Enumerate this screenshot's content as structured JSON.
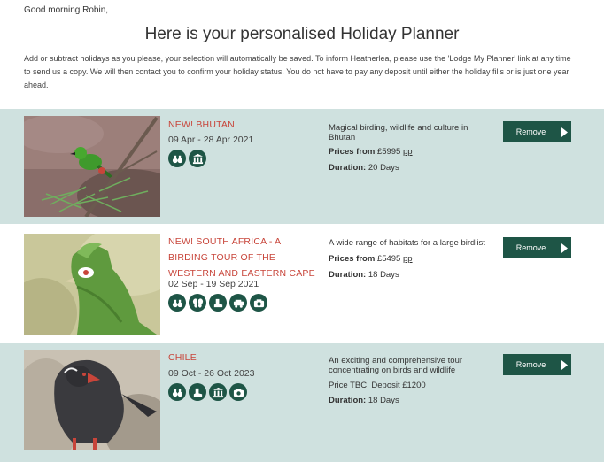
{
  "greeting": "Good morning Robin,",
  "page_title": "Here is your personalised Holiday Planner",
  "intro": "Add or subtract holidays as you please, your selection will automatically be saved. To inform Heatherlea, please use the 'Lodge My Planner' link at any time to send us a copy. We will then contact you to confirm your holiday status. You do not have to pay any deposit until either the holiday fills or is just one year ahead.",
  "colors": {
    "accent": "#1e5546",
    "title_red": "#c8453a",
    "row_shade": "#cfe1df"
  },
  "tours": [
    {
      "title": "NEW! BHUTAN",
      "dates": "09 Apr - 28 Apr 2021",
      "icons": [
        "binoculars-icon",
        "culture-icon"
      ],
      "description": "Magical birding, wildlife and culture in Bhutan",
      "price_label": "Prices from",
      "price_value": "£5995",
      "price_suffix": "pp",
      "duration_label": "Duration:",
      "duration_value": "20 Days",
      "remove_label": "Remove"
    },
    {
      "title": "NEW! SOUTH AFRICA - A BIRDING TOUR OF THE WESTERN AND EASTERN CAPE",
      "dates": "02 Sep - 19 Sep 2021",
      "icons": [
        "binoculars-icon",
        "butterfly-icon",
        "walking-boot-icon",
        "vehicle-icon",
        "camera-icon"
      ],
      "description": "A wide range of habitats for a large birdlist",
      "price_label": "Prices from",
      "price_value": "£5495",
      "price_suffix": "pp",
      "duration_label": "Duration:",
      "duration_value": "18 Days",
      "remove_label": "Remove"
    },
    {
      "title": "CHILE",
      "dates": "09 Oct - 26 Oct 2023",
      "icons": [
        "binoculars-icon",
        "walking-boot-icon",
        "culture-icon",
        "camera-icon"
      ],
      "description": "An exciting and comprehensive tour concentrating on birds and wildlife",
      "price_text": "Price TBC. Deposit £1200",
      "duration_label": "Duration:",
      "duration_value": "18 Days",
      "remove_label": "Remove"
    }
  ]
}
